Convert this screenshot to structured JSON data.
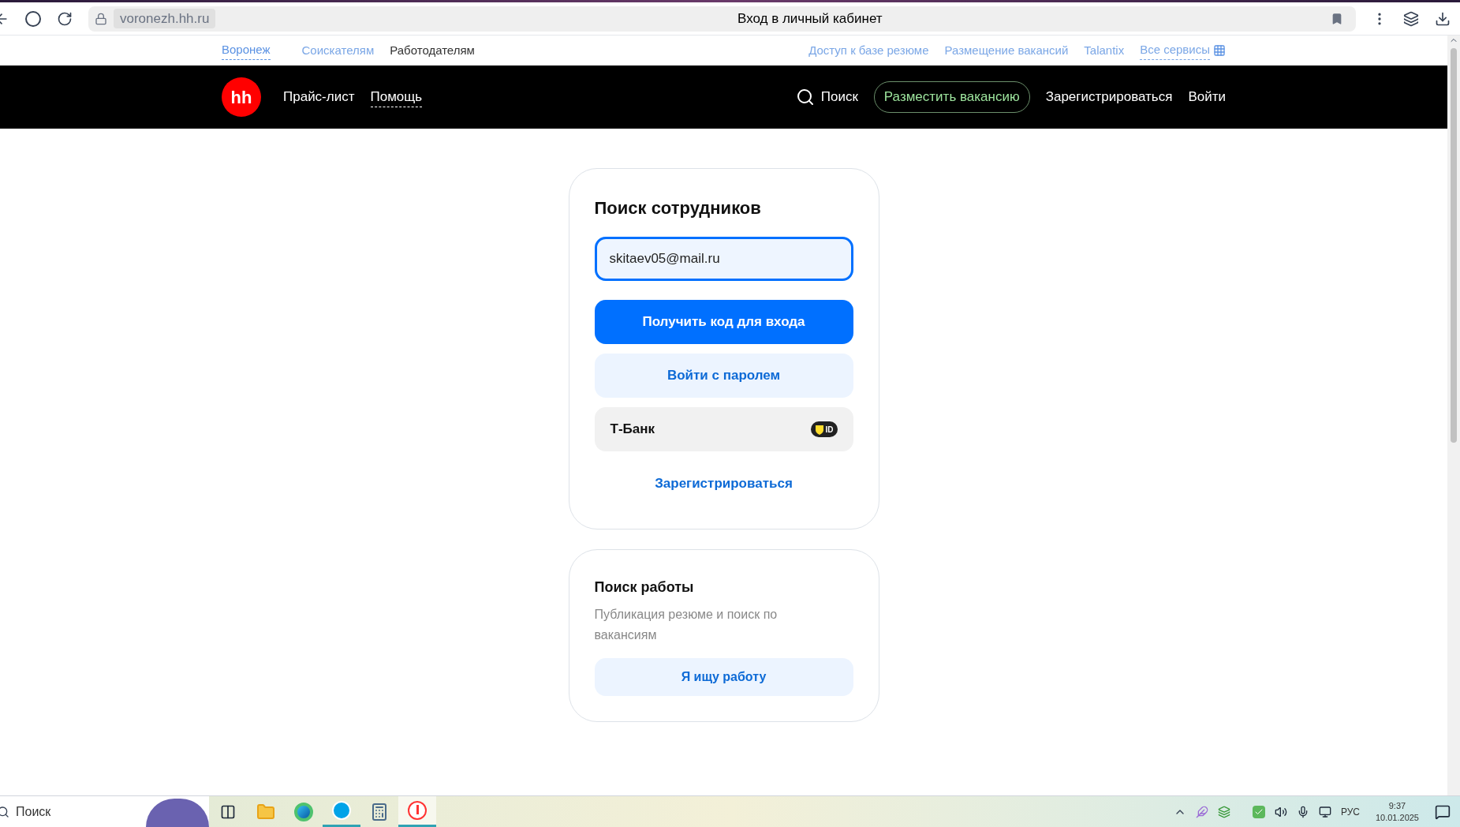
{
  "browser": {
    "url": "voronezh.hh.ru",
    "title": "Вход в личный кабинет"
  },
  "top_links": {
    "city": "Воронеж",
    "left": [
      {
        "label": "Соискателям",
        "selected": false
      },
      {
        "label": "Работодателям",
        "selected": true
      }
    ],
    "right": [
      "Доступ к базе резюме",
      "Размещение вакансий",
      "Talantix"
    ],
    "services": "Все сервисы"
  },
  "header": {
    "logo": "hh",
    "nav": [
      "Прайс-лист",
      "Помощь"
    ],
    "search": "Поиск",
    "post_button": "Разместить вакансию",
    "register": "Зарегистрироваться",
    "login": "Войти"
  },
  "login_card": {
    "title": "Поиск сотрудников",
    "email": "skitaev05@mail.ru",
    "primary_button": "Получить код для входа",
    "password_button": "Войти с паролем",
    "tbank": {
      "label": "Т-Банк",
      "badge": "ID"
    },
    "register_link": "Зарегистрироваться"
  },
  "job_card": {
    "title": "Поиск работы",
    "description": "Публикация резюме и поиск по вакансиям",
    "button": "Я ищу работу"
  },
  "taskbar": {
    "search": "Поиск",
    "apps": [
      {
        "kind": "taskview",
        "active": false
      },
      {
        "kind": "folder",
        "active": false
      },
      {
        "kind": "edge",
        "active": false
      },
      {
        "kind": "skype",
        "active": true
      },
      {
        "kind": "calculator",
        "active": false
      },
      {
        "kind": "yandex",
        "active": true
      }
    ],
    "language": "РУС",
    "time": "9:37",
    "date": "10.01.2025"
  }
}
